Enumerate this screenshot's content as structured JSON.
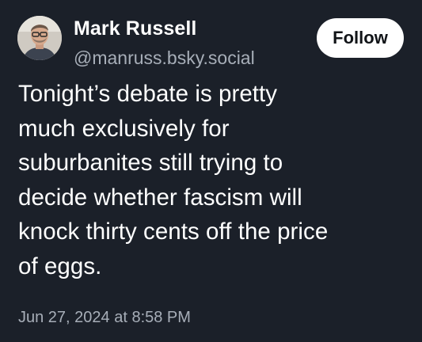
{
  "author": {
    "display_name": "Mark Russell",
    "handle": "@manruss.bsky.social"
  },
  "follow_button": {
    "label": "Follow"
  },
  "post": {
    "lines": [
      "Tonight’s debate is pretty",
      "much exclusively for",
      "suburbanites still trying to",
      "decide whether fascism will",
      "knock thirty cents off the price",
      "of eggs."
    ],
    "timestamp": "Jun 27, 2024 at 8:58 PM"
  },
  "colors": {
    "background": "#1b2029",
    "primary_text": "#ffffff",
    "secondary_text": "#a7aeb8",
    "follow_button_bg": "#ffffff",
    "follow_button_text": "#111418"
  },
  "icons": {
    "avatar": "user-avatar-photo"
  }
}
